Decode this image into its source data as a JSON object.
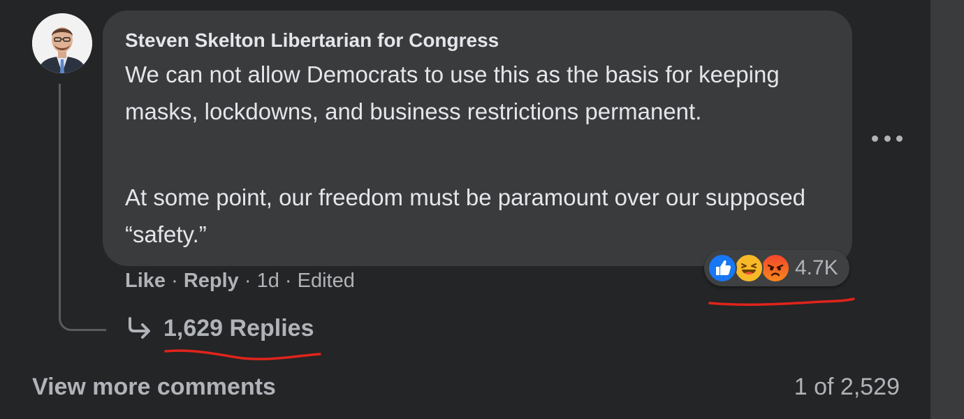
{
  "comment": {
    "author": "Steven Skelton Libertarian for Congress",
    "paragraphs": [
      "We can not allow Democrats to use this as the basis for keeping masks, lockdowns, and business restrictions permanent.",
      "At some point, our freedom must be paramount over our supposed “safety.”"
    ],
    "reactions": {
      "icons": [
        "like-icon",
        "haha-icon",
        "angry-icon"
      ],
      "count": "4.7K"
    },
    "actions": {
      "like_label": "Like",
      "reply_label": "Reply",
      "separator": " · ",
      "time": "1d",
      "edited": "Edited"
    },
    "replies_label": "1,629 Replies"
  },
  "footer": {
    "view_more_label": "View more comments",
    "pager": "1 of 2,529"
  },
  "colors": {
    "background": "#242526",
    "bubble": "#3a3b3c",
    "text_primary": "#e4e6eb",
    "text_secondary": "#b0b3b8",
    "annotation_underline": "#e0241c"
  }
}
